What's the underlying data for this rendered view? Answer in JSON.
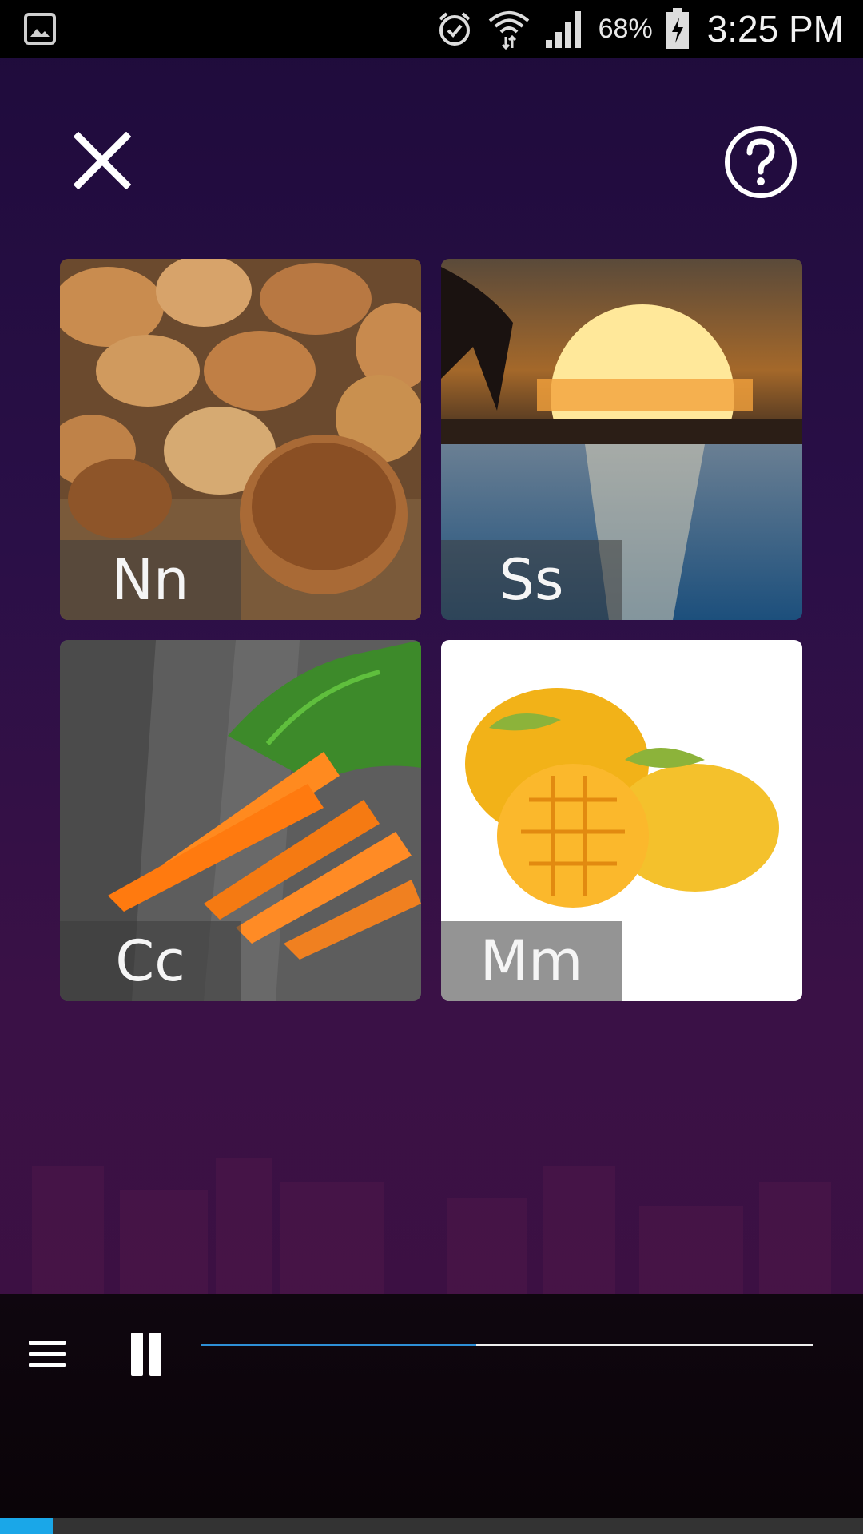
{
  "status_bar": {
    "battery_percent": "68%",
    "time": "3:25 PM",
    "icons": [
      "gallery-icon",
      "alarm-icon",
      "wifi-icon",
      "signal-icon",
      "battery-charging-icon"
    ]
  },
  "header": {
    "close_icon": "close-icon",
    "help_icon": "help-icon"
  },
  "cards": [
    {
      "label": "Nn",
      "image": "nuts"
    },
    {
      "label": "Ss",
      "image": "sunset"
    },
    {
      "label": "Cc",
      "image": "carrots"
    },
    {
      "label": "Mm",
      "image": "mangoes"
    }
  ],
  "player": {
    "menu_icon": "menu-icon",
    "pause_icon": "pause-icon",
    "progress": 0.45
  },
  "colors": {
    "progress_accent": "#2e8fd6",
    "background_top": "#1e0b3b",
    "background_bottom": "#3d1040"
  }
}
